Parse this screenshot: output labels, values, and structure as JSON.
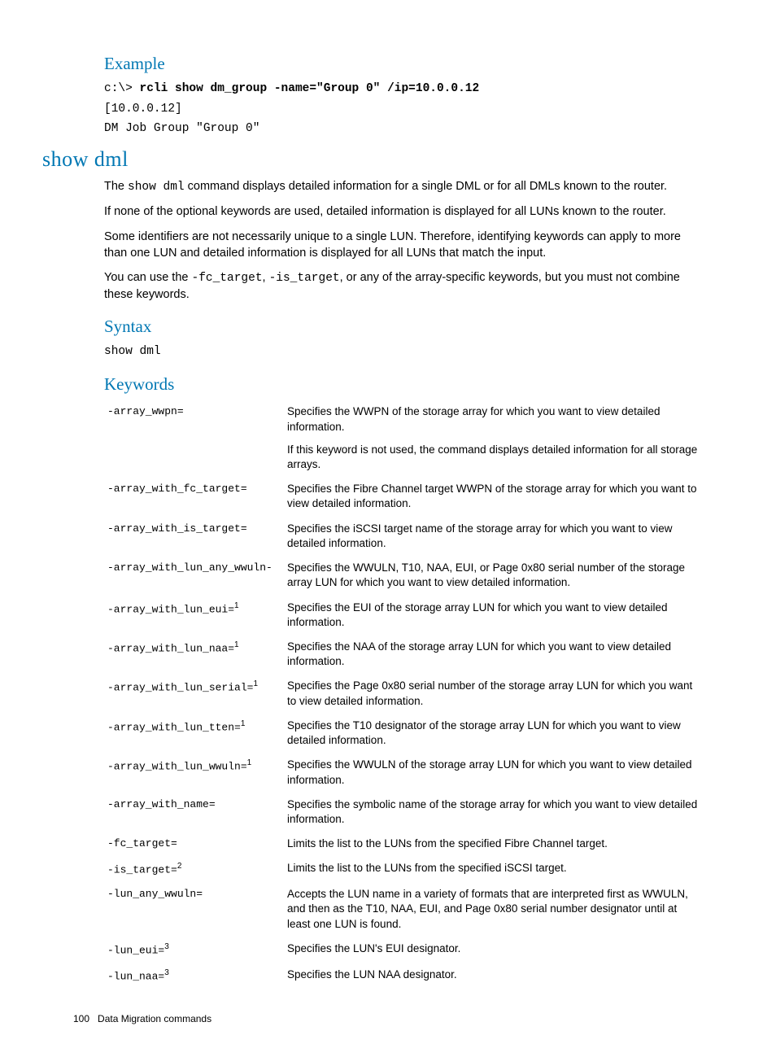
{
  "example": {
    "heading": "Example",
    "prompt": "c:\\> ",
    "command": "rcli show dm_group -name=\"Group 0\" /ip=10.0.0.12",
    "output_line1": "[10.0.0.12]",
    "output_line2": "DM Job Group \"Group 0\""
  },
  "command": {
    "title": "show dml",
    "desc1_pre": "The ",
    "desc1_code": "show dml",
    "desc1_post": " command displays detailed information for a single DML or for all DMLs known to the router.",
    "desc2": "If none of the optional keywords are used, detailed information is displayed for all LUNs known to the router.",
    "desc3": "Some identifiers are not necessarily unique to a single LUN. Therefore, identifying keywords can apply to more than one LUN and detailed information is displayed for all LUNs that match the input.",
    "desc4_pre": "You can use the ",
    "desc4_code1": "-fc_target",
    "desc4_mid": ", ",
    "desc4_code2": "-is_target",
    "desc4_post": ", or any of the array-specific keywords, but you must not combine these keywords."
  },
  "syntax": {
    "heading": "Syntax",
    "text": "show dml"
  },
  "keywords": {
    "heading": "Keywords",
    "rows": [
      {
        "name": "-array_wwpn=",
        "fn": "",
        "desc": "Specifies the WWPN of the storage array for which you want to view detailed information.",
        "desc2": "If this keyword is not used, the command displays detailed information for all storage arrays."
      },
      {
        "name": "-array_with_fc_target=",
        "fn": "",
        "desc": "Specifies the Fibre Channel target WWPN of the storage array for which you want to view detailed information."
      },
      {
        "name": "-array_with_is_target=",
        "fn": "",
        "desc": "Specifies the iSCSI target name of the storage array for which you want to view detailed information."
      },
      {
        "name": "-array_with_lun_any_wwuln-",
        "fn": "",
        "desc": "Specifies the WWULN, T10, NAA, EUI, or Page 0x80 serial number of the storage array LUN for which you want to view detailed information."
      },
      {
        "name": "-array_with_lun_eui=",
        "fn": "1",
        "desc": "Specifies the EUI of the storage array LUN for which you want to view detailed information."
      },
      {
        "name": "-array_with_lun_naa=",
        "fn": "1",
        "desc": "Specifies the NAA of the storage array LUN for which you want to view detailed information."
      },
      {
        "name": "-array_with_lun_serial=",
        "fn": "1",
        "desc": "Specifies the Page 0x80 serial number of the storage array LUN for which you want to view detailed information."
      },
      {
        "name": "-array_with_lun_tten=",
        "fn": "1",
        "desc": "Specifies the T10 designator of the storage array LUN for which you want to view detailed information."
      },
      {
        "name": "-array_with_lun_wwuln=",
        "fn": "1",
        "desc": "Specifies the WWULN of the storage array LUN for which you want to view detailed information."
      },
      {
        "name": "-array_with_name=",
        "fn": "",
        "desc": "Specifies the symbolic name of the storage array for which you want to view detailed information."
      },
      {
        "name": "-fc_target=",
        "fn": "",
        "desc": "Limits the list to the LUNs from the specified Fibre Channel target."
      },
      {
        "name": "-is_target=",
        "fn": "2",
        "desc": "Limits the list to the LUNs from the specified iSCSI target."
      },
      {
        "name": "-lun_any_wwuln=",
        "fn": "",
        "desc": "Accepts the LUN name in a variety of formats that are interpreted first as WWULN, and then as the T10, NAA, EUI, and Page 0x80 serial number designator until at least one LUN is found."
      },
      {
        "name": "-lun_eui=",
        "fn": "3",
        "desc": "Specifies the LUN's EUI designator."
      },
      {
        "name": "-lun_naa=",
        "fn": "3",
        "desc": "Specifies the LUN NAA designator."
      }
    ]
  },
  "footer": {
    "page": "100",
    "label": "Data Migration commands"
  }
}
